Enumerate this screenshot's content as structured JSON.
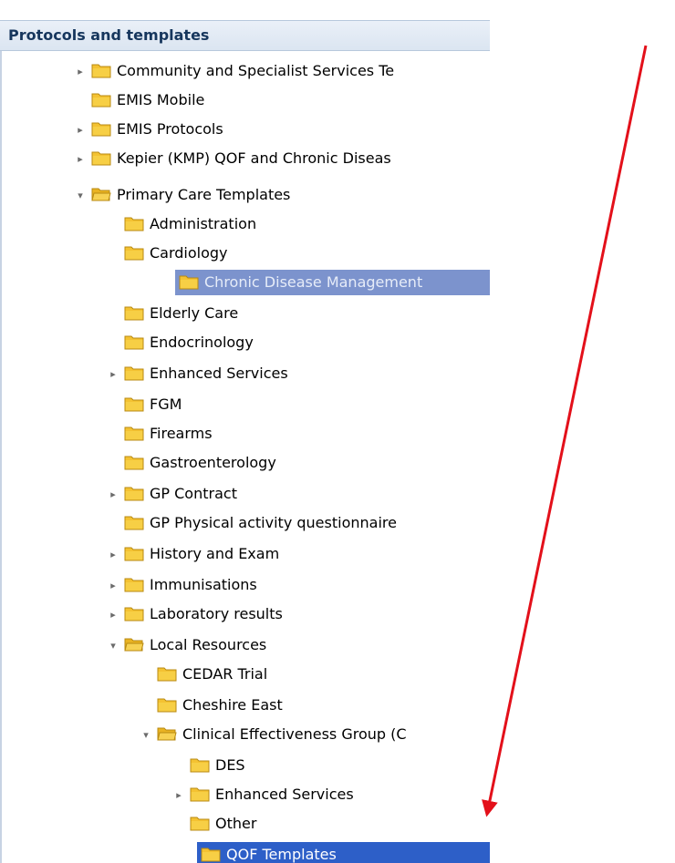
{
  "panel": {
    "title": "Protocols and templates"
  },
  "tree": [
    {
      "label": "Community and Specialist Services Te",
      "expander": "collapsed",
      "expanded": false,
      "selected": "none"
    },
    {
      "label": "EMIS Mobile",
      "expander": "none",
      "expanded": false,
      "selected": "none"
    },
    {
      "label": "EMIS Protocols",
      "expander": "collapsed",
      "expanded": false,
      "selected": "none"
    },
    {
      "label": "Kepier (KMP) QOF and Chronic Diseas",
      "expander": "collapsed",
      "expanded": false,
      "selected": "none"
    },
    {
      "label": "Primary Care Templates",
      "expander": "expanded",
      "expanded": true,
      "selected": "none"
    },
    {
      "label": "Administration",
      "expander": "none",
      "expanded": false,
      "selected": "none"
    },
    {
      "label": "Cardiology",
      "expander": "none",
      "expanded": false,
      "selected": "none"
    },
    {
      "label": "Chronic Disease Management",
      "expander": "none",
      "expanded": false,
      "selected": "inactive"
    },
    {
      "label": "Elderly Care",
      "expander": "none",
      "expanded": false,
      "selected": "none"
    },
    {
      "label": "Endocrinology",
      "expander": "none",
      "expanded": false,
      "selected": "none"
    },
    {
      "label": "Enhanced Services",
      "expander": "collapsed",
      "expanded": false,
      "selected": "none"
    },
    {
      "label": "FGM",
      "expander": "none",
      "expanded": false,
      "selected": "none"
    },
    {
      "label": "Firearms",
      "expander": "none",
      "expanded": false,
      "selected": "none"
    },
    {
      "label": "Gastroenterology",
      "expander": "none",
      "expanded": false,
      "selected": "none"
    },
    {
      "label": "GP Contract",
      "expander": "collapsed",
      "expanded": false,
      "selected": "none"
    },
    {
      "label": "GP Physical activity questionnaire",
      "expander": "none",
      "expanded": false,
      "selected": "none"
    },
    {
      "label": "History and Exam",
      "expander": "collapsed",
      "expanded": false,
      "selected": "none"
    },
    {
      "label": "Immunisations",
      "expander": "collapsed",
      "expanded": false,
      "selected": "none"
    },
    {
      "label": "Laboratory results",
      "expander": "collapsed",
      "expanded": false,
      "selected": "none"
    },
    {
      "label": "Local Resources",
      "expander": "expanded",
      "expanded": true,
      "selected": "none"
    },
    {
      "label": "CEDAR Trial",
      "expander": "none",
      "expanded": false,
      "selected": "none"
    },
    {
      "label": "Cheshire East",
      "expander": "none",
      "expanded": false,
      "selected": "none"
    },
    {
      "label": "Clinical Effectiveness Group (C",
      "expander": "expanded",
      "expanded": true,
      "selected": "none"
    },
    {
      "label": "DES",
      "expander": "none",
      "expanded": false,
      "selected": "none"
    },
    {
      "label": "Enhanced Services",
      "expander": "collapsed",
      "expanded": false,
      "selected": "none"
    },
    {
      "label": "Other",
      "expander": "none",
      "expanded": false,
      "selected": "none"
    },
    {
      "label": "QOF Templates",
      "expander": "none",
      "expanded": false,
      "selected": "active"
    }
  ],
  "annotation": {
    "color": "#e3101a"
  },
  "colors": {
    "folder_fill": "#f4c232",
    "folder_edge": "#b88a12",
    "selection_inactive": "#7c93cd",
    "selection_active": "#2d5fc8"
  }
}
